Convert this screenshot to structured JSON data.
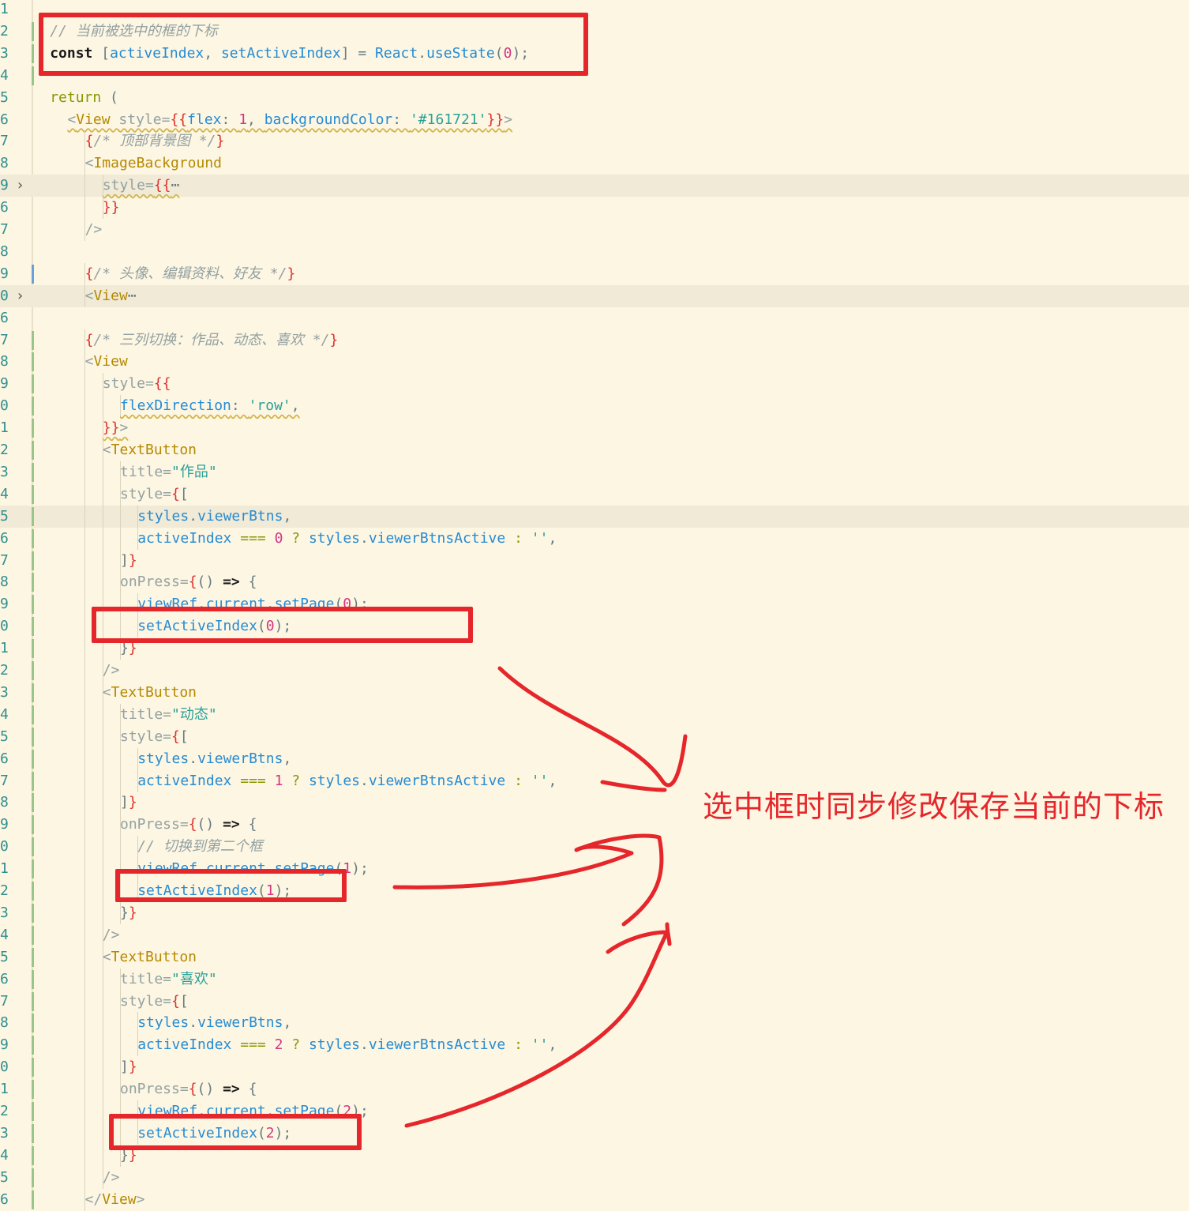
{
  "editor": {
    "rows": [
      {
        "ln": "1",
        "tokens": []
      },
      {
        "ln": "2",
        "tokens": [
          {
            "t": "// 当前被选中的框的下标",
            "c": "cmt"
          }
        ]
      },
      {
        "ln": "3",
        "tokens": [
          {
            "t": "const ",
            "c": "kw"
          },
          {
            "t": "[",
            "c": "pun"
          },
          {
            "t": "activeIndex",
            "c": "var"
          },
          {
            "t": ", ",
            "c": "pun"
          },
          {
            "t": "setActiveIndex",
            "c": "var"
          },
          {
            "t": "] = ",
            "c": "pun"
          },
          {
            "t": "React",
            "c": "var"
          },
          {
            "t": ".",
            "c": "pun"
          },
          {
            "t": "useState",
            "c": "var"
          },
          {
            "t": "(",
            "c": "pun"
          },
          {
            "t": "0",
            "c": "num"
          },
          {
            "t": ");",
            "c": "pun"
          }
        ]
      },
      {
        "ln": "4",
        "tokens": []
      },
      {
        "ln": "5",
        "tokens": [
          {
            "t": "return ",
            "c": "key"
          },
          {
            "t": "(",
            "c": "pun"
          }
        ]
      },
      {
        "ln": "6",
        "tokens": [
          {
            "t": "<",
            "c": "jsx"
          },
          {
            "t": "View ",
            "c": "tag"
          },
          {
            "t": "style=",
            "c": "attr"
          },
          {
            "t": "{{",
            "c": "brace"
          },
          {
            "t": "flex",
            "c": "var"
          },
          {
            "t": ": ",
            "c": "pun"
          },
          {
            "t": "1",
            "c": "num"
          },
          {
            "t": ", ",
            "c": "pun"
          },
          {
            "t": "backgroundColor",
            "c": "var"
          },
          {
            "t": ": ",
            "c": "pun"
          },
          {
            "t": "'#161721'",
            "c": "str"
          },
          {
            "t": "}}",
            "c": "brace"
          },
          {
            "t": ">",
            "c": "jsx"
          }
        ]
      },
      {
        "ln": "7",
        "tokens": [
          {
            "t": "{",
            "c": "brace"
          },
          {
            "t": "/* 顶部背景图 */",
            "c": "cmt"
          },
          {
            "t": "}",
            "c": "brace"
          }
        ]
      },
      {
        "ln": "8",
        "tokens": [
          {
            "t": "<",
            "c": "jsx"
          },
          {
            "t": "ImageBackground",
            "c": "tag"
          }
        ]
      },
      {
        "ln": "9",
        "tokens": [
          {
            "t": "style=",
            "c": "attr"
          },
          {
            "t": "{{",
            "c": "brace"
          },
          {
            "t": "⋯",
            "c": "pun"
          }
        ]
      },
      {
        "ln": "6",
        "tokens": [
          {
            "t": "}}",
            "c": "brace"
          }
        ]
      },
      {
        "ln": "7",
        "tokens": [
          {
            "t": "/>",
            "c": "jsx"
          }
        ]
      },
      {
        "ln": "8",
        "tokens": []
      },
      {
        "ln": "9",
        "tokens": [
          {
            "t": "{",
            "c": "brace"
          },
          {
            "t": "/* 头像、编辑资料、好友 */",
            "c": "cmt"
          },
          {
            "t": "}",
            "c": "brace"
          }
        ]
      },
      {
        "ln": "0",
        "tokens": [
          {
            "t": "<",
            "c": "jsx"
          },
          {
            "t": "View",
            "c": "tag"
          },
          {
            "t": "⋯",
            "c": "pun"
          }
        ]
      },
      {
        "ln": "6",
        "tokens": []
      },
      {
        "ln": "7",
        "tokens": [
          {
            "t": "{",
            "c": "brace"
          },
          {
            "t": "/* 三列切换：作品、动态、喜欢 */",
            "c": "cmt"
          },
          {
            "t": "}",
            "c": "brace"
          }
        ]
      },
      {
        "ln": "8",
        "tokens": [
          {
            "t": "<",
            "c": "jsx"
          },
          {
            "t": "View",
            "c": "tag"
          }
        ]
      },
      {
        "ln": "9",
        "tokens": [
          {
            "t": "style=",
            "c": "attr"
          },
          {
            "t": "{{",
            "c": "brace"
          }
        ]
      },
      {
        "ln": "0",
        "tokens": [
          {
            "t": "flexDirection",
            "c": "var"
          },
          {
            "t": ": ",
            "c": "pun"
          },
          {
            "t": "'row'",
            "c": "str"
          },
          {
            "t": ",",
            "c": "pun"
          }
        ]
      },
      {
        "ln": "1",
        "tokens": [
          {
            "t": "}}",
            "c": "brace"
          },
          {
            "t": ">",
            "c": "jsx"
          }
        ]
      },
      {
        "ln": "2",
        "tokens": [
          {
            "t": "<",
            "c": "jsx"
          },
          {
            "t": "TextButton",
            "c": "tag"
          }
        ]
      },
      {
        "ln": "3",
        "tokens": [
          {
            "t": "title=",
            "c": "attr"
          },
          {
            "t": "\"作品\"",
            "c": "str"
          }
        ]
      },
      {
        "ln": "4",
        "tokens": [
          {
            "t": "style=",
            "c": "attr"
          },
          {
            "t": "{",
            "c": "brace"
          },
          {
            "t": "[",
            "c": "pun"
          }
        ]
      },
      {
        "ln": "5",
        "tokens": [
          {
            "t": "styles",
            "c": "var"
          },
          {
            "t": ".",
            "c": "pun"
          },
          {
            "t": "viewerBtns",
            "c": "var"
          },
          {
            "t": ",",
            "c": "pun"
          }
        ]
      },
      {
        "ln": "6",
        "tokens": [
          {
            "t": "activeIndex ",
            "c": "var"
          },
          {
            "t": "=== ",
            "c": "key"
          },
          {
            "t": "0 ",
            "c": "num"
          },
          {
            "t": "? ",
            "c": "key"
          },
          {
            "t": "styles",
            "c": "var"
          },
          {
            "t": ".",
            "c": "pun"
          },
          {
            "t": "viewerBtnsActive ",
            "c": "var"
          },
          {
            "t": ": ",
            "c": "key"
          },
          {
            "t": "''",
            "c": "str"
          },
          {
            "t": ",",
            "c": "pun"
          }
        ]
      },
      {
        "ln": "7",
        "tokens": [
          {
            "t": "]",
            "c": "pun"
          },
          {
            "t": "}",
            "c": "brace"
          }
        ]
      },
      {
        "ln": "8",
        "tokens": [
          {
            "t": "onPress=",
            "c": "attr"
          },
          {
            "t": "{",
            "c": "brace"
          },
          {
            "t": "() ",
            "c": "pun"
          },
          {
            "t": "=> ",
            "c": "kw"
          },
          {
            "t": "{",
            "c": "pun"
          }
        ]
      },
      {
        "ln": "9",
        "tokens": [
          {
            "t": "viewRef",
            "c": "var"
          },
          {
            "t": ".",
            "c": "pun"
          },
          {
            "t": "current",
            "c": "var"
          },
          {
            "t": ".",
            "c": "pun"
          },
          {
            "t": "setPage",
            "c": "var"
          },
          {
            "t": "(",
            "c": "pun"
          },
          {
            "t": "0",
            "c": "num"
          },
          {
            "t": ");",
            "c": "pun"
          }
        ]
      },
      {
        "ln": "0",
        "tokens": [
          {
            "t": "setActiveIndex",
            "c": "var"
          },
          {
            "t": "(",
            "c": "pun"
          },
          {
            "t": "0",
            "c": "num"
          },
          {
            "t": ");",
            "c": "pun"
          }
        ]
      },
      {
        "ln": "1",
        "tokens": [
          {
            "t": "}",
            "c": "pun"
          },
          {
            "t": "}",
            "c": "brace"
          }
        ]
      },
      {
        "ln": "2",
        "tokens": [
          {
            "t": "/>",
            "c": "jsx"
          }
        ]
      },
      {
        "ln": "3",
        "tokens": [
          {
            "t": "<",
            "c": "jsx"
          },
          {
            "t": "TextButton",
            "c": "tag"
          }
        ]
      },
      {
        "ln": "4",
        "tokens": [
          {
            "t": "title=",
            "c": "attr"
          },
          {
            "t": "\"动态\"",
            "c": "str"
          }
        ]
      },
      {
        "ln": "5",
        "tokens": [
          {
            "t": "style=",
            "c": "attr"
          },
          {
            "t": "{",
            "c": "brace"
          },
          {
            "t": "[",
            "c": "pun"
          }
        ]
      },
      {
        "ln": "6",
        "tokens": [
          {
            "t": "styles",
            "c": "var"
          },
          {
            "t": ".",
            "c": "pun"
          },
          {
            "t": "viewerBtns",
            "c": "var"
          },
          {
            "t": ",",
            "c": "pun"
          }
        ]
      },
      {
        "ln": "7",
        "tokens": [
          {
            "t": "activeIndex ",
            "c": "var"
          },
          {
            "t": "=== ",
            "c": "key"
          },
          {
            "t": "1 ",
            "c": "num"
          },
          {
            "t": "? ",
            "c": "key"
          },
          {
            "t": "styles",
            "c": "var"
          },
          {
            "t": ".",
            "c": "pun"
          },
          {
            "t": "viewerBtnsActive ",
            "c": "var"
          },
          {
            "t": ": ",
            "c": "key"
          },
          {
            "t": "''",
            "c": "str"
          },
          {
            "t": ",",
            "c": "pun"
          }
        ]
      },
      {
        "ln": "8",
        "tokens": [
          {
            "t": "]",
            "c": "pun"
          },
          {
            "t": "}",
            "c": "brace"
          }
        ]
      },
      {
        "ln": "9",
        "tokens": [
          {
            "t": "onPress=",
            "c": "attr"
          },
          {
            "t": "{",
            "c": "brace"
          },
          {
            "t": "() ",
            "c": "pun"
          },
          {
            "t": "=> ",
            "c": "kw"
          },
          {
            "t": "{",
            "c": "pun"
          }
        ]
      },
      {
        "ln": "0",
        "tokens": [
          {
            "t": "// 切换到第二个框",
            "c": "cmt"
          }
        ]
      },
      {
        "ln": "1",
        "tokens": [
          {
            "t": "viewRef",
            "c": "var"
          },
          {
            "t": ".",
            "c": "pun"
          },
          {
            "t": "current",
            "c": "var"
          },
          {
            "t": ".",
            "c": "pun"
          },
          {
            "t": "setPage",
            "c": "var"
          },
          {
            "t": "(",
            "c": "pun"
          },
          {
            "t": "1",
            "c": "num"
          },
          {
            "t": ");",
            "c": "pun"
          }
        ]
      },
      {
        "ln": "2",
        "tokens": [
          {
            "t": "setActiveIndex",
            "c": "var"
          },
          {
            "t": "(",
            "c": "pun"
          },
          {
            "t": "1",
            "c": "num"
          },
          {
            "t": ");",
            "c": "pun"
          }
        ]
      },
      {
        "ln": "3",
        "tokens": [
          {
            "t": "}",
            "c": "pun"
          },
          {
            "t": "}",
            "c": "brace"
          }
        ]
      },
      {
        "ln": "4",
        "tokens": [
          {
            "t": "/>",
            "c": "jsx"
          }
        ]
      },
      {
        "ln": "5",
        "tokens": [
          {
            "t": "<",
            "c": "jsx"
          },
          {
            "t": "TextButton",
            "c": "tag"
          }
        ]
      },
      {
        "ln": "6",
        "tokens": [
          {
            "t": "title=",
            "c": "attr"
          },
          {
            "t": "\"喜欢\"",
            "c": "str"
          }
        ]
      },
      {
        "ln": "7",
        "tokens": [
          {
            "t": "style=",
            "c": "attr"
          },
          {
            "t": "{",
            "c": "brace"
          },
          {
            "t": "[",
            "c": "pun"
          }
        ]
      },
      {
        "ln": "8",
        "tokens": [
          {
            "t": "styles",
            "c": "var"
          },
          {
            "t": ".",
            "c": "pun"
          },
          {
            "t": "viewerBtns",
            "c": "var"
          },
          {
            "t": ",",
            "c": "pun"
          }
        ]
      },
      {
        "ln": "9",
        "tokens": [
          {
            "t": "activeIndex ",
            "c": "var"
          },
          {
            "t": "=== ",
            "c": "key"
          },
          {
            "t": "2 ",
            "c": "num"
          },
          {
            "t": "? ",
            "c": "key"
          },
          {
            "t": "styles",
            "c": "var"
          },
          {
            "t": ".",
            "c": "pun"
          },
          {
            "t": "viewerBtnsActive ",
            "c": "var"
          },
          {
            "t": ": ",
            "c": "key"
          },
          {
            "t": "''",
            "c": "str"
          },
          {
            "t": ",",
            "c": "pun"
          }
        ]
      },
      {
        "ln": "0",
        "tokens": [
          {
            "t": "]",
            "c": "pun"
          },
          {
            "t": "}",
            "c": "brace"
          }
        ]
      },
      {
        "ln": "1",
        "tokens": [
          {
            "t": "onPress=",
            "c": "attr"
          },
          {
            "t": "{",
            "c": "brace"
          },
          {
            "t": "() ",
            "c": "pun"
          },
          {
            "t": "=> ",
            "c": "kw"
          },
          {
            "t": "{",
            "c": "pun"
          }
        ]
      },
      {
        "ln": "2",
        "tokens": [
          {
            "t": "viewRef",
            "c": "var"
          },
          {
            "t": ".",
            "c": "pun"
          },
          {
            "t": "current",
            "c": "var"
          },
          {
            "t": ".",
            "c": "pun"
          },
          {
            "t": "setPage",
            "c": "var"
          },
          {
            "t": "(",
            "c": "pun"
          },
          {
            "t": "2",
            "c": "num"
          },
          {
            "t": ");",
            "c": "pun"
          }
        ]
      },
      {
        "ln": "3",
        "tokens": [
          {
            "t": "setActiveIndex",
            "c": "var"
          },
          {
            "t": "(",
            "c": "pun"
          },
          {
            "t": "2",
            "c": "num"
          },
          {
            "t": ");",
            "c": "pun"
          }
        ]
      },
      {
        "ln": "4",
        "tokens": [
          {
            "t": "}",
            "c": "pun"
          },
          {
            "t": "}",
            "c": "brace"
          }
        ]
      },
      {
        "ln": "5",
        "tokens": [
          {
            "t": "/>",
            "c": "jsx"
          }
        ]
      },
      {
        "ln": "6",
        "tokens": [
          {
            "t": "</",
            "c": "jsx"
          },
          {
            "t": "View",
            "c": "tag"
          },
          {
            "t": ">",
            "c": "jsx"
          }
        ]
      }
    ]
  },
  "annotation": {
    "text": "选中框时同步修改保存当前的下标",
    "color": "#e5262b"
  },
  "colors": {
    "background": "#fdf6e3",
    "line_number": "#2f8f8f",
    "keyword": "#859900",
    "variable": "#268bd2",
    "number": "#d33682",
    "string": "#2aa198",
    "comment": "#93a1a1",
    "tag": "#b58900",
    "brace": "#dc322f"
  },
  "icons": [
    "fold-chevron-icon"
  ]
}
